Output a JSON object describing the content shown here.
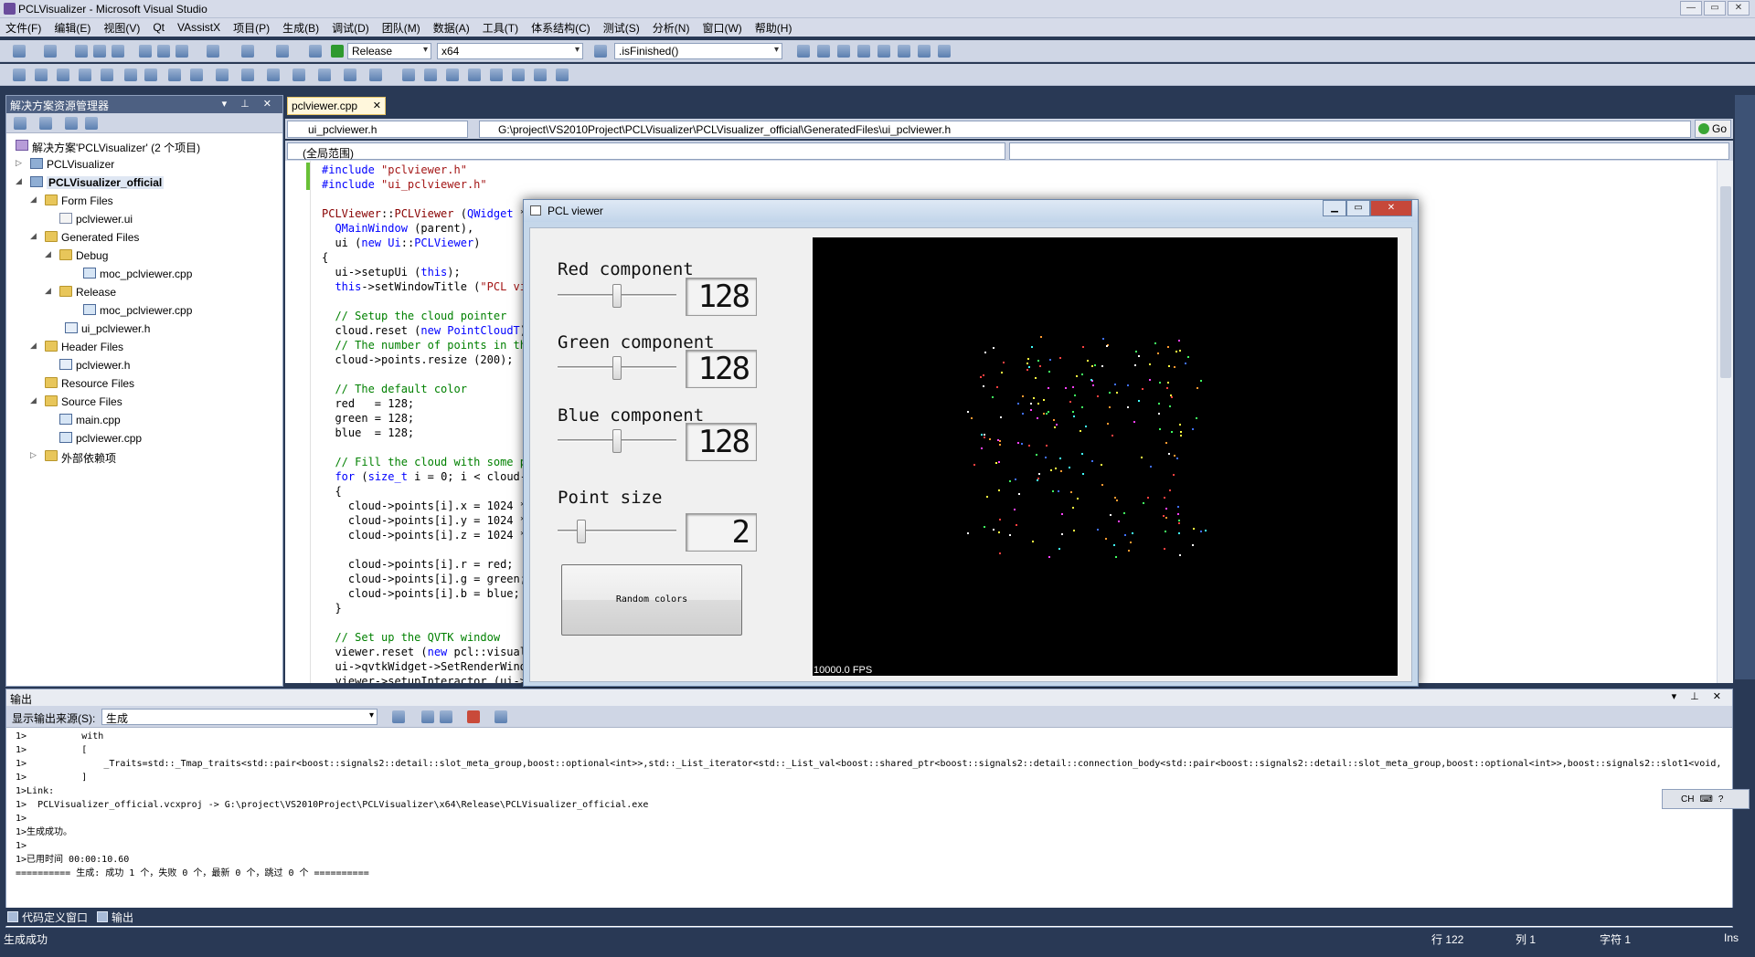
{
  "window": {
    "title": "PCLVisualizer - Microsoft Visual Studio",
    "controls": [
      "—",
      "▭",
      "✕"
    ]
  },
  "menu": [
    "文件(F)",
    "编辑(E)",
    "视图(V)",
    "Qt",
    "VAssistX",
    "项目(P)",
    "生成(B)",
    "调试(D)",
    "团队(M)",
    "数据(A)",
    "工具(T)",
    "体系结构(C)",
    "测试(S)",
    "分析(N)",
    "窗口(W)",
    "帮助(H)"
  ],
  "toolbar": {
    "config": "Release",
    "platform": "x64",
    "find": ".isFinished()"
  },
  "solution_explorer": {
    "title": "解决方案资源管理器",
    "items": [
      {
        "label": "解决方案'PCLVisualizer' (2 个项目)"
      },
      {
        "label": "PCLVisualizer"
      },
      {
        "label": "PCLVisualizer_official"
      },
      {
        "label": "Form Files"
      },
      {
        "label": "pclviewer.ui"
      },
      {
        "label": "Generated Files"
      },
      {
        "label": "Debug"
      },
      {
        "label": "moc_pclviewer.cpp"
      },
      {
        "label": "Release"
      },
      {
        "label": "moc_pclviewer.cpp"
      },
      {
        "label": "ui_pclviewer.h"
      },
      {
        "label": "Header Files"
      },
      {
        "label": "pclviewer.h"
      },
      {
        "label": "Resource Files"
      },
      {
        "label": "Source Files"
      },
      {
        "label": "main.cpp"
      },
      {
        "label": "pclviewer.cpp"
      },
      {
        "label": "外部依赖项"
      }
    ]
  },
  "editor": {
    "tab": "pclviewer.cpp",
    "file_dropdown": "ui_pclviewer.h",
    "path": "G:\\project\\VS2010Project\\PCLVisualizer\\PCLVisualizer_official\\GeneratedFiles\\ui_pclviewer.h",
    "go": "Go",
    "scope": "(全局范围)"
  },
  "pcl_window": {
    "title": "PCL viewer",
    "red_label": "Red component",
    "red_value": "128",
    "green_label": "Green component",
    "green_value": "128",
    "blue_label": "Blue component",
    "blue_value": "128",
    "size_label": "Point size",
    "size_value": "2",
    "button": "Random colors",
    "fps": "10000.0 FPS",
    "red_level": 0.5,
    "green_level": 0.5,
    "blue_level": 0.5,
    "size_level": 0.2
  },
  "output": {
    "title": "输出",
    "source_label": "显示输出来源(S):",
    "source_value": "生成",
    "lines": [
      "1>          with",
      "1>          [",
      "1>              _Traits=std::_Tmap_traits<std::pair<boost::signals2::detail::slot_meta_group,boost::optional<int>>,std::_List_iterator<std::_List_val<boost::shared_ptr<boost::signals2::detail::connection_body<std::pair<boost::signals2::detail::slot_meta_group,boost::optional<int>>,boost::signals2::slot1<void,",
      "1>          ]",
      "1>Link:",
      "1>  PCLVisualizer_official.vcxproj -> G:\\project\\VS2010Project\\PCLVisualizer\\x64\\Release\\PCLVisualizer_official.exe",
      "1>",
      "1>生成成功。",
      "1>",
      "1>已用时间 00:00:10.60",
      "========== 生成: 成功 1 个，失败 0 个，最新 0 个，跳过 0 个 =========="
    ]
  },
  "bottom_tabs": [
    "代码定义窗口",
    "输出"
  ],
  "status": {
    "message": "生成成功",
    "line": "行 122",
    "col": "列 1",
    "char": "字符 1",
    "mode": "Ins"
  },
  "ime": "CH"
}
